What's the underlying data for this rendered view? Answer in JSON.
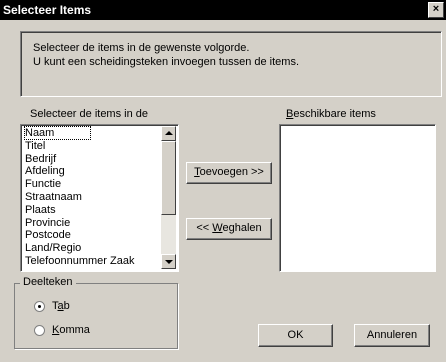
{
  "window": {
    "title": "Selecteer Items",
    "close_glyph": "×"
  },
  "info": {
    "line1": "Selecteer de items in de gewenste volgorde.",
    "line2": "U kunt een scheidingsteken invoegen tussen de items."
  },
  "left_list": {
    "label": "Selecteer de items in de",
    "items": [
      "Naam",
      "Titel",
      "Bedrijf",
      "Afdeling",
      "Functie",
      "Straatnaam",
      "Plaats",
      "Provincie",
      "Postcode",
      "Land/Regio",
      "Telefoonnummer Zaak"
    ],
    "selected_index": 0
  },
  "buttons": {
    "add_prefix": "",
    "add_mnemonic": "T",
    "add_rest": "oevoegen >>",
    "remove_prefix": "<< ",
    "remove_mnemonic": "W",
    "remove_rest": "eghalen",
    "ok": "OK",
    "cancel": "Annuleren"
  },
  "right_list": {
    "label_mnemonic": "B",
    "label_rest": "eschikbare items",
    "items": []
  },
  "delimiter": {
    "title": "Deelteken",
    "options": [
      {
        "pre": "T",
        "mnemonic": "a",
        "post": "b",
        "checked": true
      },
      {
        "pre": "",
        "mnemonic": "K",
        "post": "omma",
        "checked": false
      }
    ]
  }
}
